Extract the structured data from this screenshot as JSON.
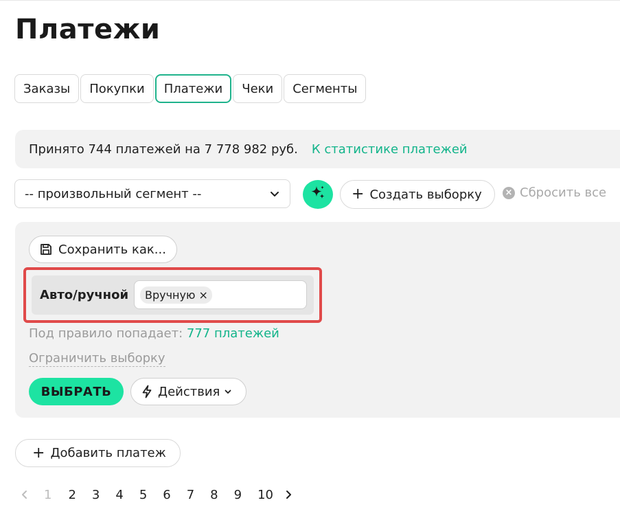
{
  "page": {
    "title": "Платежи"
  },
  "tabs": [
    {
      "label": "Заказы",
      "active": false
    },
    {
      "label": "Покупки",
      "active": false
    },
    {
      "label": "Платежи",
      "active": true
    },
    {
      "label": "Чеки",
      "active": false
    },
    {
      "label": "Сегменты",
      "active": false
    }
  ],
  "stats": {
    "summary": "Принято 744 платежей на 7 778 982 руб.",
    "link": "К статистике платежей"
  },
  "toolbar": {
    "segment_value": "-- произвольный сегмент --",
    "magic_icon": "sparkle-icon",
    "create_label": "Создать выборку",
    "reset_label": "Сбросить все"
  },
  "filter": {
    "save_label": "Сохранить как...",
    "rule": {
      "label": "Авто/ручной",
      "chips": [
        {
          "label": "Вручную",
          "remove": "×"
        }
      ]
    },
    "match_prefix": "Под правило попадает:",
    "match_count": "777 платежей",
    "limit_label": "Ограничить выборку",
    "select_label": "ВЫБРАТЬ",
    "actions_label": "Действия"
  },
  "add_payment_label": "Добавить платеж",
  "pagination": {
    "pages": [
      "1",
      "2",
      "3",
      "4",
      "5",
      "6",
      "7",
      "8",
      "9",
      "10"
    ],
    "current": "1"
  },
  "colors": {
    "accent": "#1de3a2",
    "link": "#12b48a",
    "active_tab_border": "#1fb38c",
    "highlight_border": "#e04a4a",
    "panel_bg": "#f2f2f2"
  }
}
